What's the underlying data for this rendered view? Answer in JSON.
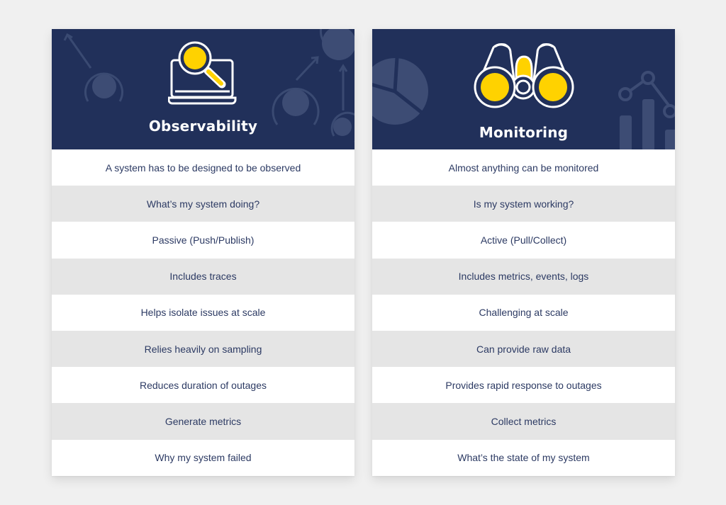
{
  "colors": {
    "header_bg": "#21305a",
    "accent_yellow": "#ffd200",
    "row_text": "#2c3a63",
    "row_alt_bg": "#e5e5e5",
    "page_bg": "#f0f0f0"
  },
  "cards": [
    {
      "title": "Observability",
      "icon": "laptop-magnifier-icon",
      "rows": [
        "A system has to be designed to be observed",
        "What’s my system doing?",
        "Passive (Push/Publish)",
        "Includes traces",
        "Helps isolate issues at scale",
        "Relies heavily on sampling",
        "Reduces duration of outages",
        "Generate metrics",
        "Why my system failed"
      ]
    },
    {
      "title": "Monitoring",
      "icon": "binoculars-icon",
      "rows": [
        "Almost anything can be monitored",
        "Is my system working?",
        "Active (Pull/Collect)",
        "Includes metrics, events, logs",
        "Challenging at scale",
        "Can provide raw data",
        "Provides rapid response to outages",
        "Collect metrics",
        "What’s the state of my system"
      ]
    }
  ]
}
